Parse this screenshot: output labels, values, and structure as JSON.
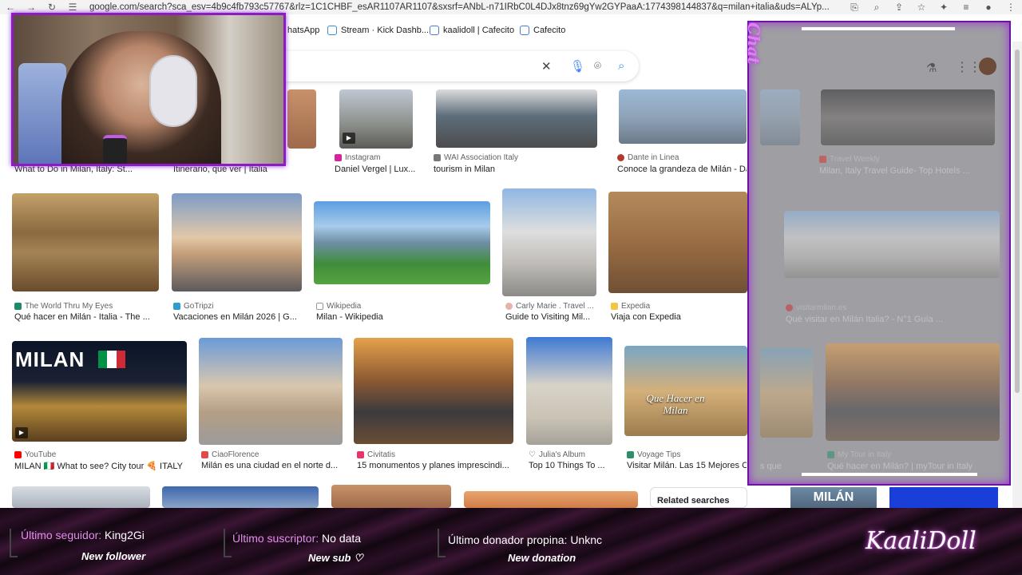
{
  "browser": {
    "url": "google.com/search?sca_esv=4b9c4fb793c57767&rlz=1C1CHBF_esAR1107AR1107&sxsrf=ANbL-n71IRbC0L4DJx8tnz69gYw2GYPaaA:1774398144837&q=milan+italia&uds=ALYp...",
    "bookmarks": [
      {
        "label": "hatsApp"
      },
      {
        "label": "Stream · Kick Dashb..."
      },
      {
        "label": "kaalidoll | Cafecito"
      },
      {
        "label": "Cafecito"
      }
    ]
  },
  "results": {
    "row1": [
      {
        "caption": "What to Do in Milan, Italy: St..."
      },
      {
        "caption": "Itinerario, qué ver | Italia"
      },
      {
        "source": "Instagram",
        "caption": "Daniel Vergel | Lux..."
      },
      {
        "source": "WAI Association Italy",
        "caption": "tourism in Milan"
      },
      {
        "source": "Dante in Linea",
        "caption": "Conoce la grandeza de Milán - Da..."
      }
    ],
    "row2": [
      {
        "source": "The World Thru My Eyes",
        "caption": "Qué hacer en Milán - Italia - The ..."
      },
      {
        "source": "GoTripzi",
        "caption": "Vacaciones en Milán 2026 | G..."
      },
      {
        "source": "Wikipedia",
        "caption": "Milan - Wikipedia"
      },
      {
        "source": "Carly Marie . Travel ...",
        "caption": "Guide to Visiting Mil..."
      },
      {
        "source": "Expedia",
        "caption": "Viaja con Expedia"
      }
    ],
    "row3": [
      {
        "source": "YouTube",
        "caption": "MILAN 🇮🇹 What to see? City tour 🍕 ITALY ..."
      },
      {
        "source": "CiaoFlorence",
        "caption": "Milán es una ciudad en el norte d..."
      },
      {
        "source": "Civitatis",
        "caption": "15 monumentos y planes imprescindi..."
      },
      {
        "source": "Julia's Album",
        "caption": "Top 10 Things To ..."
      },
      {
        "source": "Voyage Tips",
        "caption": "Visitar Milán. Las 15 Mejores Co..."
      }
    ],
    "milan_overlay": "MILAN",
    "que_hacer_overlay": "Que Hacer en Milan",
    "related_searches": "Related searches"
  },
  "chat": {
    "title": "Chat",
    "items": [
      {
        "source": "Travel Weekly",
        "caption": "Milan, Italy Travel Guide- Top Hotels ..."
      },
      {
        "source": "visitarmilan.es",
        "caption": "Qué visitar en Milán Italia? - N°1 Guía ..."
      },
      {
        "source": "My Tour in Italy",
        "caption": "Qué hacer en Milán? | myTour in Italy"
      }
    ],
    "caption_tail": "s que",
    "banner": "MILÁN"
  },
  "overlay": {
    "follower_label": "Último seguidor:",
    "follower_value": "King2Gi",
    "follower_sub": "New follower",
    "sub_label": "Último suscriptor:",
    "sub_value": "No data",
    "sub_sub": "New sub ♡",
    "donor_label": "Último donador propina:",
    "donor_value": "Unknc",
    "donor_sub": "New donation",
    "brand": "KaaliDoll"
  },
  "colors": {
    "accent_purple": "#8a1cc2",
    "overlay_pink": "#e58cf0"
  }
}
